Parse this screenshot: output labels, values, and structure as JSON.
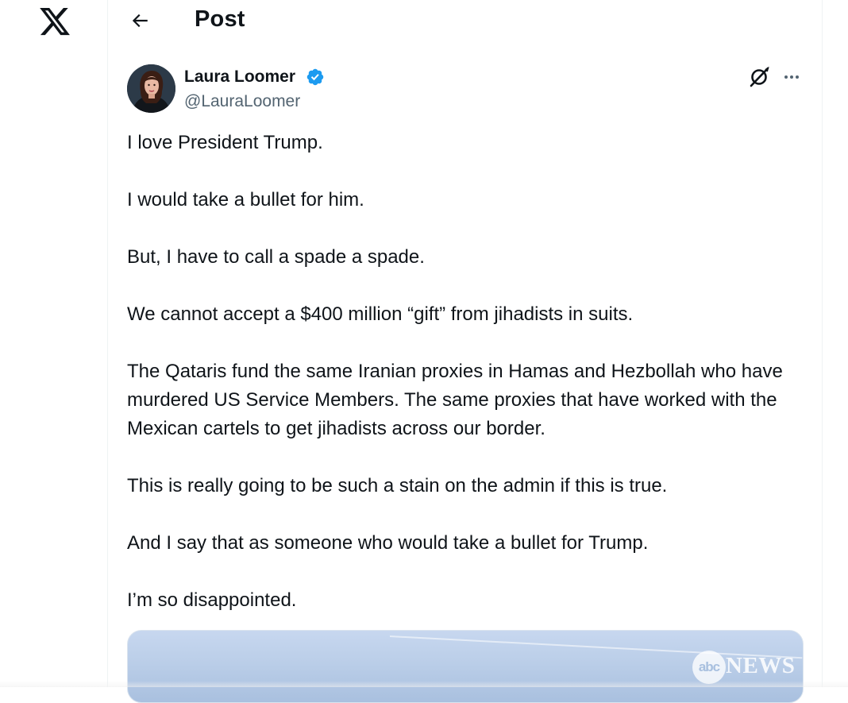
{
  "header": {
    "title": "Post",
    "logo_icon": "x-logo-icon",
    "back_icon": "arrow-left-icon"
  },
  "post": {
    "author": {
      "name": "Laura Loomer",
      "handle": "@LauraLoomer",
      "verified": true,
      "verified_color": "#1d9bf0"
    },
    "actions": {
      "grok_icon": "grok-icon",
      "more_icon": "more-horizontal-icon"
    },
    "paragraphs": [
      "I love President Trump.",
      "I would take a bullet for him.",
      "But, I have to call a spade a spade.",
      "We cannot accept a $400 million “gift” from jihadists in suits.",
      "The Qataris fund the same Iranian proxies in Hamas and Hezbollah who have murdered US Service Members. The same proxies that have worked with the Mexican cartels to get jihadists across our border.",
      "This is really going to be such a stain on the admin if this is true.",
      "And I say that as someone who would take a bullet for Trump.",
      "I’m so disappointed."
    ],
    "media": {
      "watermark_abc": "abc",
      "watermark_news": "NEWS"
    }
  },
  "colors": {
    "text_primary": "#0f1419",
    "text_secondary": "#536471",
    "accent": "#1d9bf0",
    "border": "#eff3f4"
  }
}
